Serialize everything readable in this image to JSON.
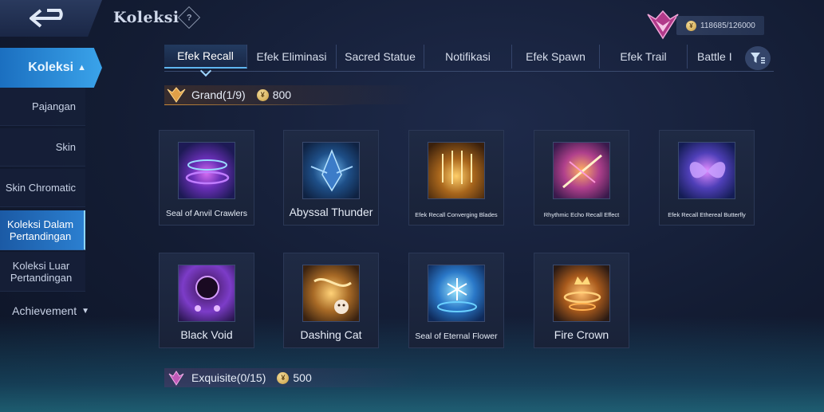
{
  "header": {
    "title": "Koleksi",
    "help_symbol": "?",
    "points_text": "118685/126000"
  },
  "sidebar": {
    "main_item": "Koleksi",
    "items": [
      {
        "label": "Pajangan"
      },
      {
        "label": "Skin"
      },
      {
        "label": "Skin Chromatic"
      },
      {
        "label": "Koleksi Dalam Pertandingan"
      },
      {
        "label": "Koleksi Luar Pertandingan"
      }
    ],
    "achievement_label": "Achievement"
  },
  "tabs": [
    {
      "label": "Efek Recall"
    },
    {
      "label": "Efek Eliminasi"
    },
    {
      "label": "Sacred Statue"
    },
    {
      "label": "Notifikasi"
    },
    {
      "label": "Efek Spawn"
    },
    {
      "label": "Efek Trail"
    },
    {
      "label": "Battle I"
    }
  ],
  "categories": [
    {
      "name": "Grand(1/9)",
      "cost": "800"
    },
    {
      "name": "Exquisite(0/15)",
      "cost": "500"
    }
  ],
  "items": [
    {
      "name": "Seal of Anvil Crawlers"
    },
    {
      "name": "Abyssal Thunder"
    },
    {
      "name": "Efek Recall Converging Blades"
    },
    {
      "name": "Rhythmic Echo Recall Effect"
    },
    {
      "name": "Efek Recall Ethereal Butterfly"
    },
    {
      "name": "Black Void"
    },
    {
      "name": "Dashing Cat"
    },
    {
      "name": "Seal of Eternal Flower"
    },
    {
      "name": "Fire Crown"
    }
  ],
  "colors": {
    "accent_blue": "#2b8fdc",
    "gold": "#c98a3a",
    "card_bg": "#1d2740"
  }
}
